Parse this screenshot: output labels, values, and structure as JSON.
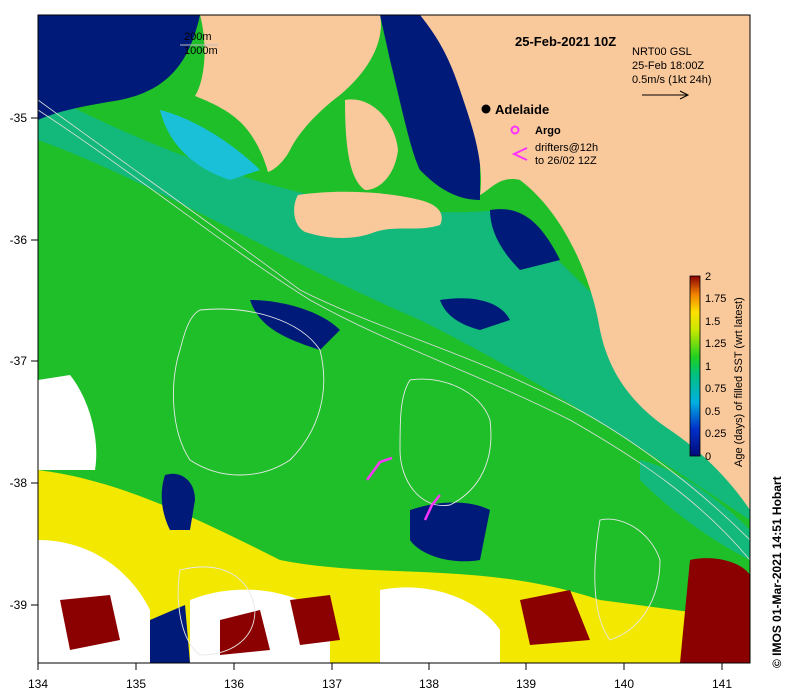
{
  "map": {
    "title": "25-Feb-2021 10Z",
    "depth_contours": [
      "200m",
      "1000m"
    ],
    "current_info": [
      "NRT00 GSL",
      "25-Feb 18:00Z",
      "0.5m/s (1kt 24h)"
    ],
    "city_label": "Adelaide",
    "legend_argo": "Argo",
    "legend_drifters": [
      "drifters@12h",
      "to 26/02 12Z"
    ],
    "colorbar_title": "Age (days) of filled SST (wrt latest)",
    "colorbar_ticks": [
      "2",
      "1.75",
      "1.5",
      "1.25",
      "1",
      "0.75",
      "0.5",
      "0.25",
      "0"
    ],
    "credit": "© IMOS 01-Mar-2021 14:51 Hobart",
    "lon_ticks": [
      "134",
      "135",
      "136",
      "137",
      "138",
      "139",
      "140",
      "141"
    ],
    "lat_ticks": [
      "-35",
      "-36",
      "-37",
      "-38",
      "-39"
    ],
    "colors": {
      "land": "#f9c89b",
      "deep_blue": "#001a7a",
      "green": "#1fbf2a",
      "teal": "#13b97a",
      "yellow": "#f2e800",
      "dark_red": "#8b0000",
      "argo": "#ff33ff"
    }
  }
}
